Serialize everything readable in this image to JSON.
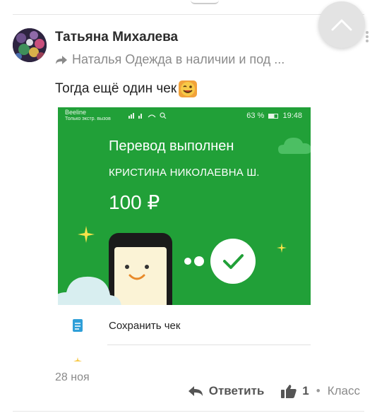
{
  "comment": {
    "author": "Татьяна Михалева",
    "forwarded_from": "Наталья Одежда в наличии и под ...",
    "text": "Тогда ещё один чек",
    "date": "28 ноя",
    "reply_label": "Ответить",
    "like_count": "1",
    "separator": "•",
    "klass_label": "Класс"
  },
  "receipt": {
    "status_carrier_line1": "Beeline",
    "status_carrier_line2": "Только экстр. вызов",
    "status_right": "63 %",
    "status_time": "19:48",
    "title": "Перевод выполнен",
    "recipient": "КРИСТИНА НИКОЛАЕВНА Ш.",
    "amount": "100 ₽",
    "menu_save": "Сохранить чек"
  },
  "colors": {
    "sber_green": "#21a038",
    "muted_text": "#8a8a8a"
  },
  "icons": {
    "scroll_up": "chevron-up-icon",
    "forward": "forward-arrow-icon",
    "emoji": "winking-face-emoji",
    "reply": "reply-arrow-icon",
    "like": "thumbs-up-icon",
    "save_receipt": "document-icon",
    "more": "kebab-menu-icon"
  }
}
